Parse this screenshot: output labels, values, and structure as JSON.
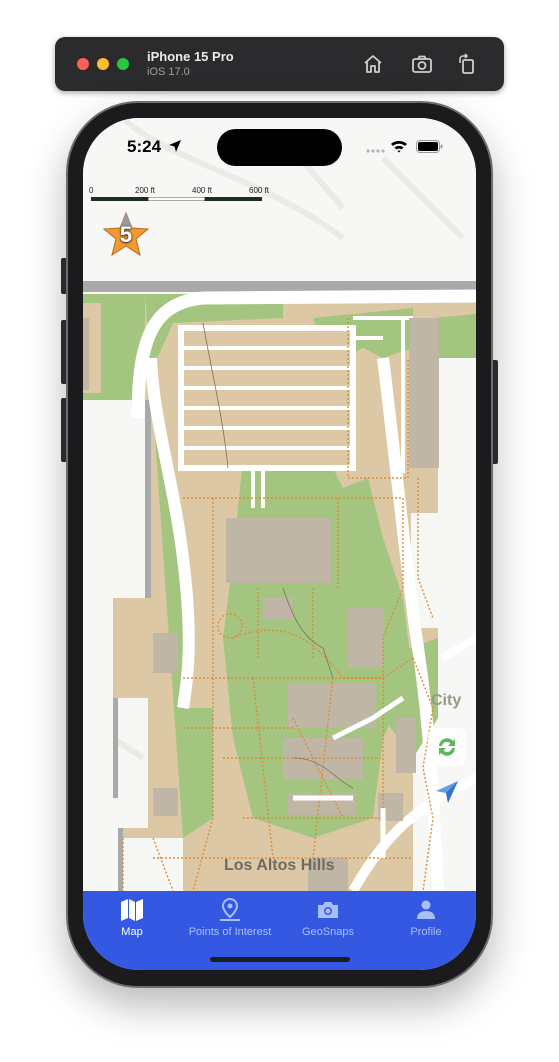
{
  "simulator": {
    "device_name": "iPhone 15 Pro",
    "os_version": "iOS 17.0",
    "buttons": [
      "home-icon",
      "screenshot-icon",
      "rotate-icon"
    ]
  },
  "status_bar": {
    "time": "5:24",
    "icons": [
      "location-arrow-icon",
      "signal-dots-icon",
      "wifi-icon",
      "battery-icon"
    ]
  },
  "map": {
    "scale_labels": [
      "0",
      "200 ft",
      "400 ft",
      "600 ft"
    ],
    "level_badge": "5",
    "place_labels": [
      "City",
      "Los Altos Hills"
    ],
    "controls": [
      "refresh-icon",
      "navigation-arrow-icon"
    ],
    "colors": {
      "park": "#a3c57f",
      "campus": "#dcc8a5",
      "building": "#bfb6a6",
      "road": "#ffffff",
      "path": "#e08a3c",
      "background": "#f7f7f5"
    }
  },
  "tab_bar": {
    "background": "#3558e2",
    "tabs": [
      {
        "label": "Map",
        "icon": "map-icon",
        "selected": true
      },
      {
        "label": "Points of Interest",
        "icon": "location-pin-icon",
        "selected": false
      },
      {
        "label": "GeoSnaps",
        "icon": "camera-icon",
        "selected": false
      },
      {
        "label": "Profile",
        "icon": "person-icon",
        "selected": false
      }
    ]
  }
}
